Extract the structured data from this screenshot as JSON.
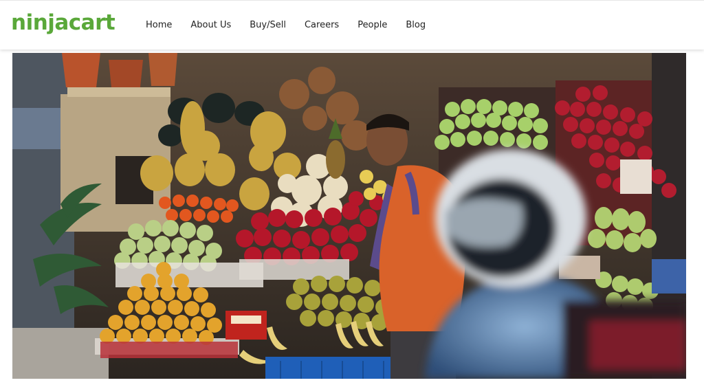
{
  "brand": {
    "logo_text": "ninjacart",
    "color": "#5aa83a"
  },
  "nav": {
    "items": [
      {
        "label": "Home"
      },
      {
        "label": "About Us"
      },
      {
        "label": "Buy/Sell"
      },
      {
        "label": "Careers"
      },
      {
        "label": "People"
      },
      {
        "label": "Blog"
      }
    ]
  },
  "hero": {
    "image_icon": "fruit-stall-photo"
  }
}
